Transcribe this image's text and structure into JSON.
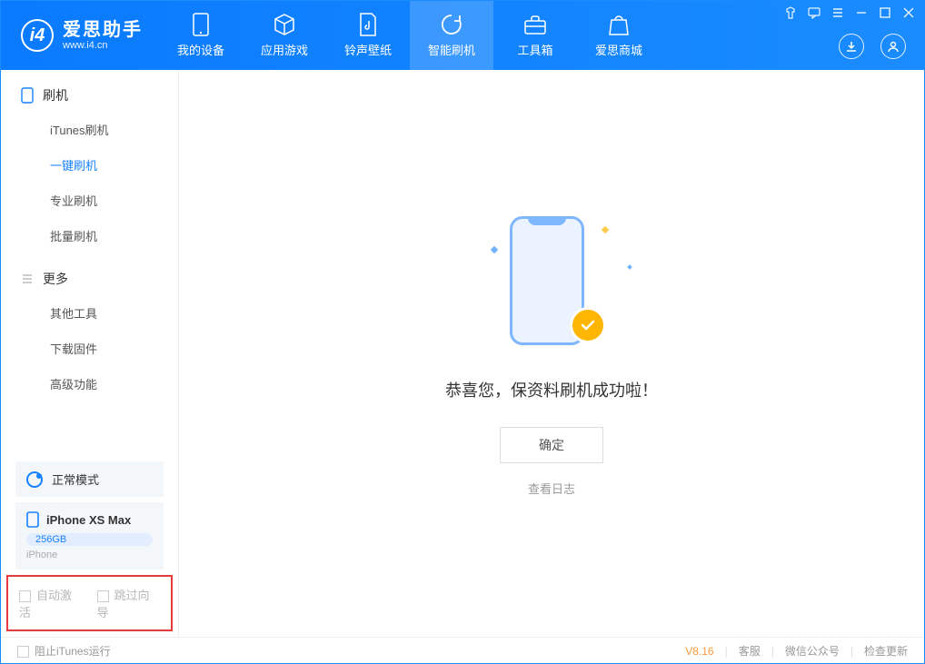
{
  "app": {
    "title": "爱思助手",
    "subtitle": "www.i4.cn"
  },
  "nav": {
    "items": [
      {
        "label": "我的设备"
      },
      {
        "label": "应用游戏"
      },
      {
        "label": "铃声壁纸"
      },
      {
        "label": "智能刷机"
      },
      {
        "label": "工具箱"
      },
      {
        "label": "爱思商城"
      }
    ]
  },
  "sidebar": {
    "section1_title": "刷机",
    "section1_items": [
      "iTunes刷机",
      "一键刷机",
      "专业刷机",
      "批量刷机"
    ],
    "section2_title": "更多",
    "section2_items": [
      "其他工具",
      "下载固件",
      "高级功能"
    ]
  },
  "device": {
    "mode": "正常模式",
    "name": "iPhone XS Max",
    "storage": "256GB",
    "type": "iPhone"
  },
  "options": {
    "auto_activate": "自动激活",
    "skip_guide": "跳过向导"
  },
  "main": {
    "success_msg": "恭喜您，保资料刷机成功啦！",
    "ok": "确定",
    "view_log": "查看日志"
  },
  "footer": {
    "block_itunes": "阻止iTunes运行",
    "version": "V8.16",
    "links": [
      "客服",
      "微信公众号",
      "检查更新"
    ]
  }
}
